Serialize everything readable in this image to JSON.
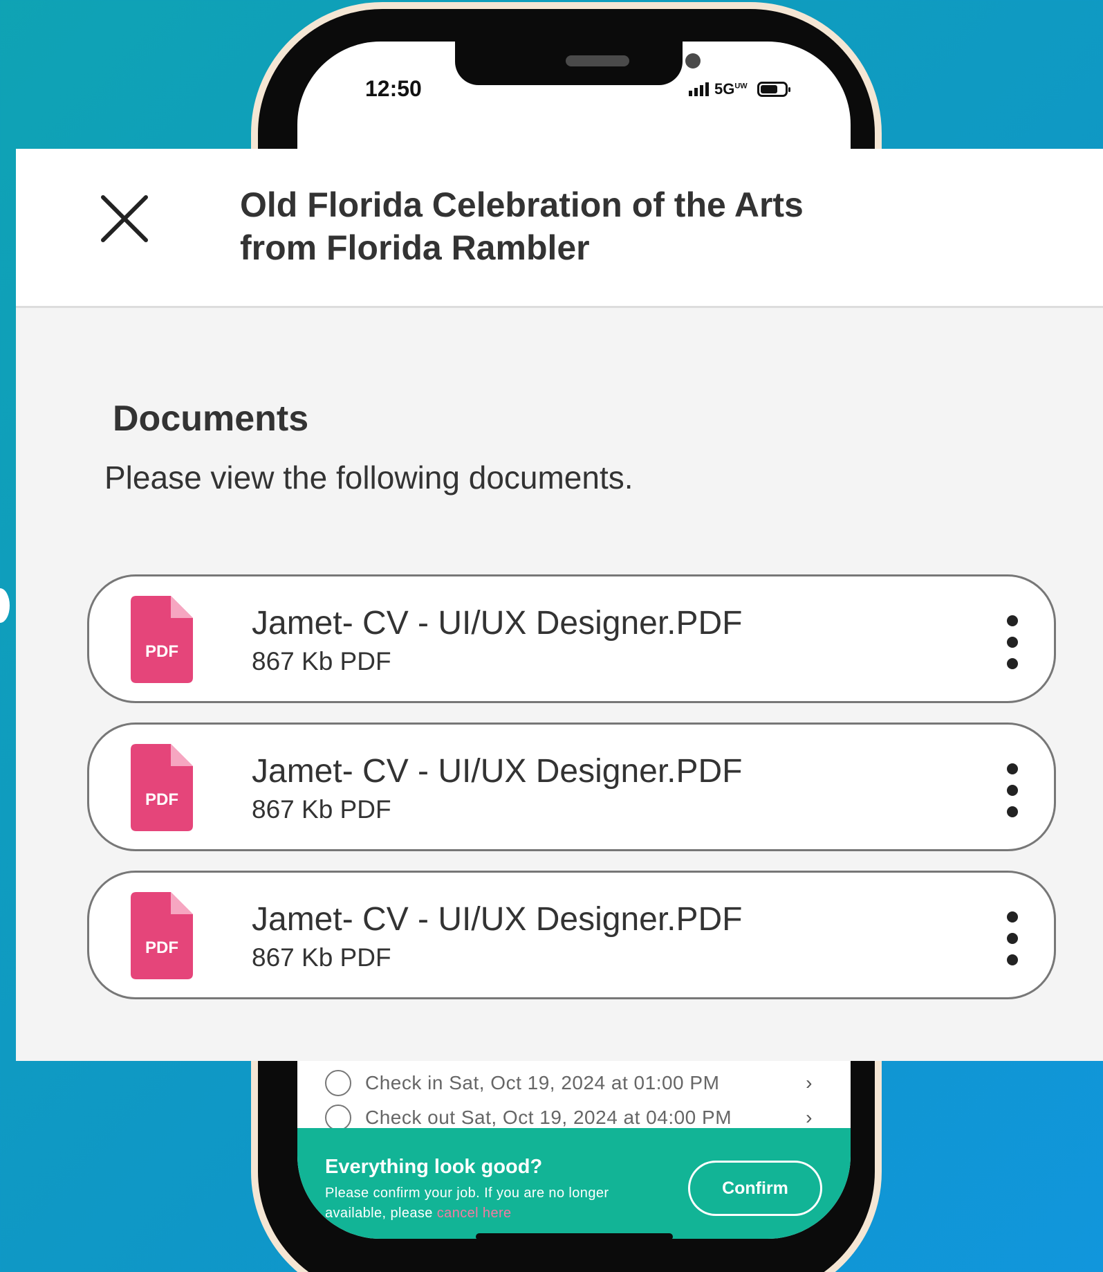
{
  "status_bar": {
    "time": "12:50",
    "network": "5G",
    "network_suffix": "UW"
  },
  "checklist": [
    {
      "label": "Check in Sat, Oct 19, 2024 at 01:00 PM"
    },
    {
      "label": "Check out Sat, Oct 19, 2024 at 04:00 PM"
    }
  ],
  "confirm_bar": {
    "title": "Everything look good?",
    "body": "Please confirm your job. If you are no longer available, please",
    "link": "cancel here",
    "button": "Confirm",
    "color": "#12b496",
    "link_color": "#f47aa2"
  },
  "modal": {
    "title": "Old Florida Celebration of the Arts from Florida Rambler",
    "close_icon": "close-icon",
    "section_title": "Documents",
    "section_subtitle": "Please view the following documents.",
    "documents": [
      {
        "icon": "pdf-file-icon",
        "icon_label": "PDF",
        "name": "Jamet- CV - UI/UX Designer.PDF",
        "meta": "867 Kb PDF"
      },
      {
        "icon": "pdf-file-icon",
        "icon_label": "PDF",
        "name": "Jamet- CV - UI/UX Designer.PDF",
        "meta": "867 Kb PDF"
      },
      {
        "icon": "pdf-file-icon",
        "icon_label": "PDF",
        "name": "Jamet- CV - UI/UX Designer.PDF",
        "meta": "867 Kb PDF"
      }
    ],
    "pdf_color": "#e5457a"
  }
}
